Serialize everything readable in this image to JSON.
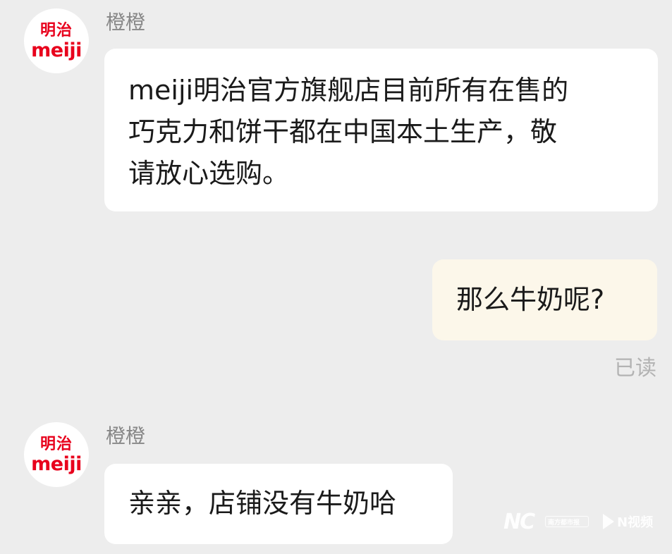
{
  "colors": {
    "background": "#ededed",
    "incoming_bubble": "#ffffff",
    "outgoing_bubble": "#fcf7ea",
    "brand_red": "#e8001c",
    "sender_name": "#888888",
    "read_status": "#b3b3b3"
  },
  "messages": [
    {
      "direction": "incoming",
      "sender": "橙橙",
      "avatar": {
        "line1": "明治",
        "line2": "meiji"
      },
      "lines": [
        "meiji明治官方旗舰店目前所有在售的",
        "巧克力和饼干都在中国本土生产，敬",
        "请放心选购。"
      ]
    },
    {
      "direction": "outgoing",
      "text": "那么牛奶呢?",
      "status": "已读"
    },
    {
      "direction": "incoming",
      "sender": "橙橙",
      "avatar": {
        "line1": "明治",
        "line2": "meiji"
      },
      "text": "亲亲，店铺没有牛奶哈"
    }
  ],
  "watermark": {
    "left_logo": "NC",
    "left_caption": "南方都市报",
    "right_logo": "N视频"
  }
}
